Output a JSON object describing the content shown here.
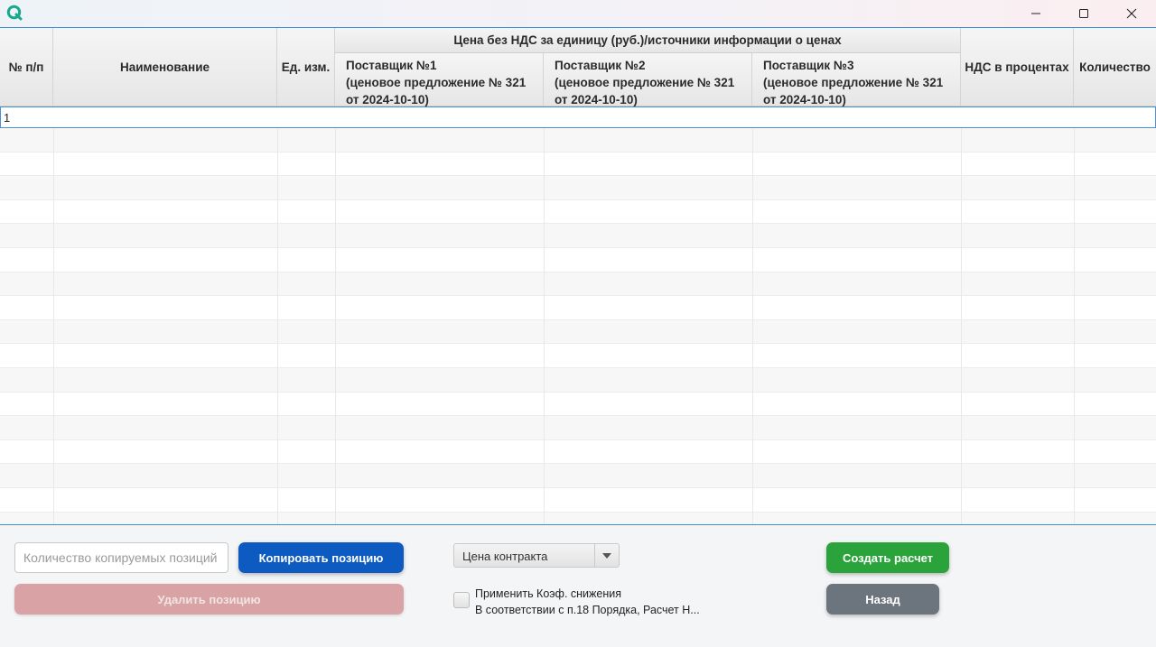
{
  "window": {
    "title_icon": "app-logo-q-icon",
    "controls": {
      "minimize_icon": "minimize-icon",
      "maximize_icon": "maximize-icon",
      "close_icon": "close-icon"
    }
  },
  "table": {
    "columns": {
      "num": "№ п/п",
      "name": "Наименование",
      "unit": "Ед. изм.",
      "price_group": "Цена без НДС за единицу (руб.)/источники информации о ценах",
      "supplier1": [
        "Поставщик №1",
        "(ценовое предложение № 321",
        "от 2024-10-10)"
      ],
      "supplier2": [
        "Поставщик №2",
        "(ценовое предложение № 321",
        "от 2024-10-10)"
      ],
      "supplier3": [
        "Поставщик №3",
        "(ценовое предложение № 321",
        "от 2024-10-10)"
      ],
      "vat": "НДС в процентах",
      "qty": "Количество"
    },
    "rows": [
      {
        "num": "1",
        "name": "",
        "unit": "",
        "supplier1": "",
        "supplier2": "",
        "supplier3": "",
        "vat": "",
        "qty": ""
      }
    ]
  },
  "controls": {
    "copy_count_placeholder": "Количество копируемых позиций",
    "copy_button": "Копировать позицию",
    "delete_button": "Удалить позицию",
    "price_select": {
      "selected": "Цена контракта"
    },
    "apply_coef_label": "Применить Коэф. снижения",
    "apply_coef_sublabel": "В соответствии с п.18 Порядка, Расчет Н...",
    "create_button": "Создать расчет",
    "back_button": "Назад"
  },
  "colors": {
    "copy_button": "#0d5bc0",
    "delete_button_disabled": "#d9a3a5",
    "create_button": "#2aa33b",
    "back_button": "#6c757d",
    "selection_border": "#4a90d9"
  }
}
